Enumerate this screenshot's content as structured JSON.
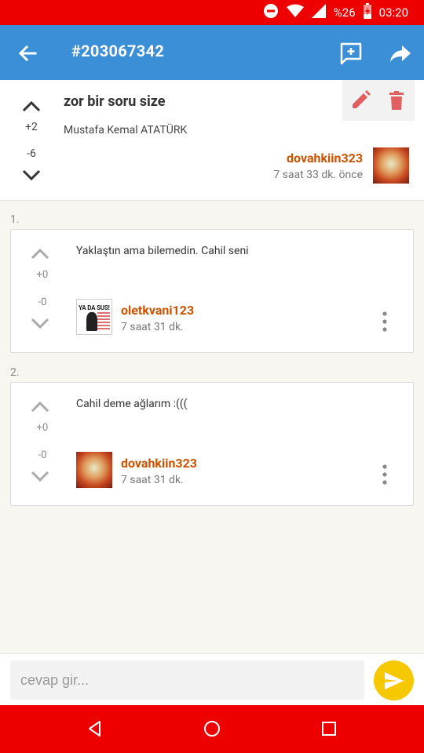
{
  "status_bar": {
    "battery": "%26",
    "time": "03:20"
  },
  "app_bar": {
    "title": "#203067342"
  },
  "question": {
    "title": "zor bir soru size",
    "body": "Mustafa Kemal ATATÜRK",
    "upvotes": "+2",
    "downvotes": "-6",
    "author": "dovahkiin323",
    "time": "7 saat 33 dk. önce"
  },
  "answers": [
    {
      "number": "1.",
      "text": "Yaklaştın ama bilemedin. Cahil seni",
      "upvotes": "+0",
      "downvotes": "-0",
      "author": "oletkvani123",
      "time": "7 saat 31 dk.",
      "avatar_text": "YA DA SUS!"
    },
    {
      "number": "2.",
      "text": "Cahil deme ağlarım :(((",
      "upvotes": "+0",
      "downvotes": "-0",
      "author": "dovahkiin323",
      "time": "7 saat 31 dk."
    }
  ],
  "reply": {
    "placeholder": "cevap gir..."
  },
  "colors": {
    "status_bar": "#ee0000",
    "app_bar": "#3a8fd6",
    "author": "#cc5200",
    "send_button": "#f5c800",
    "delete": "#e06060"
  },
  "icons": {
    "back": "arrow-left-icon",
    "add_comment": "comment-add-icon",
    "share": "share-icon",
    "edit": "pencil-icon",
    "delete": "trash-icon",
    "send": "send-icon"
  }
}
